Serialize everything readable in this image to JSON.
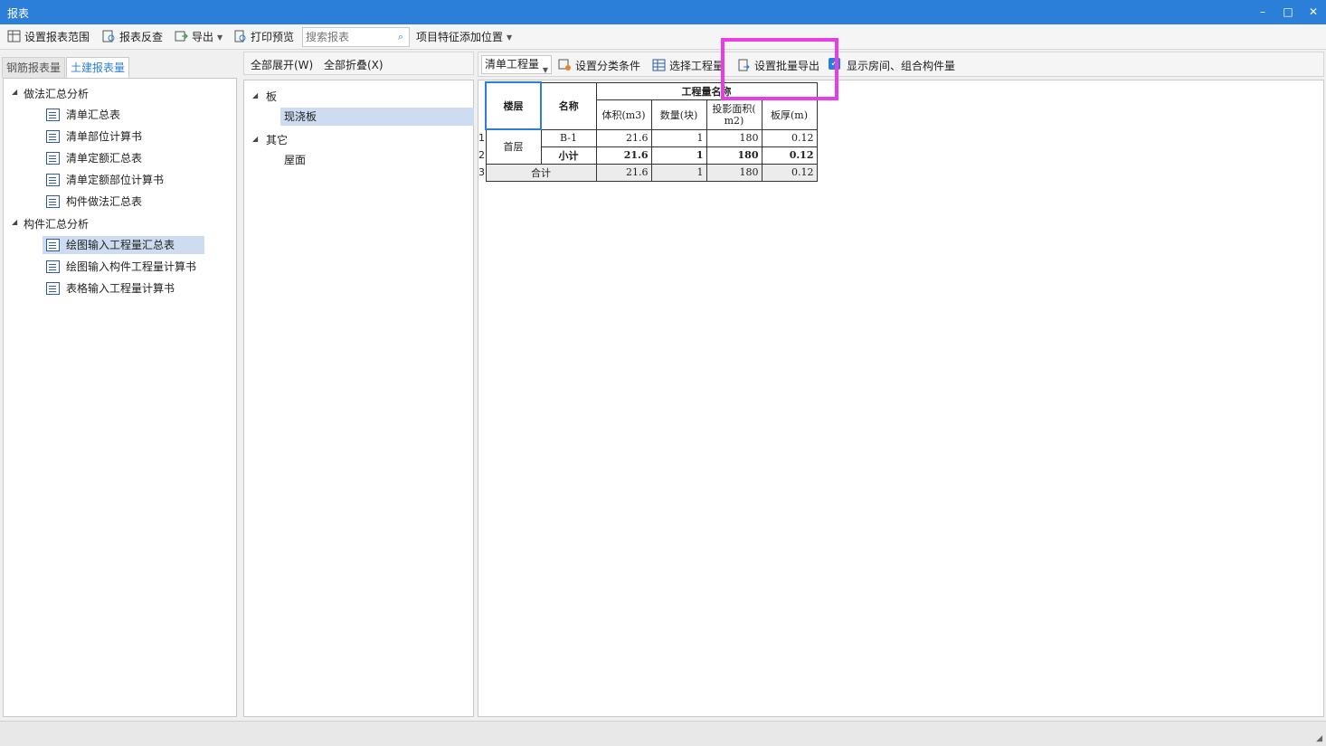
{
  "window": {
    "title": "报表",
    "minimize": "–",
    "maximize": "□",
    "close": "✕"
  },
  "toolbar": {
    "set_range": "设置报表范围",
    "reverse": "报表反查",
    "export": "导出",
    "print_preview": "打印预览",
    "search_placeholder": "搜索报表",
    "feature_position": "项目特征添加位置"
  },
  "tabs": {
    "rebar": "钢筋报表量",
    "civil": "土建报表量"
  },
  "left_tree": {
    "group1": "做法汇总分析",
    "group1_items": [
      "清单汇总表",
      "清单部位计算书",
      "清单定额汇总表",
      "清单定额部位计算书",
      "构件做法汇总表"
    ],
    "group2": "构件汇总分析",
    "group2_items": [
      "绘图输入工程量汇总表",
      "绘图输入构件工程量计算书",
      "表格输入工程量计算书"
    ]
  },
  "mid": {
    "expand_all": "全部展开(W)",
    "collapse_all": "全部折叠(X)",
    "node1": "板",
    "node1_child": "现浇板",
    "node2": "其它",
    "node2_child": "屋面"
  },
  "right_toolbar": {
    "combo_value": "清单工程量",
    "set_category": "设置分类条件",
    "select_quantity": "选择工程量",
    "batch_export": "设置批量导出",
    "show_rooms": "显示房间、组合构件量"
  },
  "report": {
    "headers": {
      "floor": "楼层",
      "name": "名称",
      "quantity_name": "工程量名称",
      "volume": "体积(m3)",
      "count": "数量(块)",
      "area_line1": "投影面积(",
      "area_line2": "m2)",
      "thickness": "板厚(m)"
    },
    "row_numbers": [
      "1",
      "2",
      "3"
    ],
    "row1": {
      "floor": "首层",
      "name": "B-1",
      "volume": "21.6",
      "count": "1",
      "area": "180",
      "thickness": "0.12"
    },
    "row2": {
      "name": "小计",
      "volume": "21.6",
      "count": "1",
      "area": "180",
      "thickness": "0.12"
    },
    "row3": {
      "label": "合计",
      "volume": "21.6",
      "count": "1",
      "area": "180",
      "thickness": "0.12"
    }
  },
  "colors": {
    "accent": "#2b7fd8",
    "highlight_box": "#e83ce6",
    "selected_row": "#cddcf0"
  }
}
